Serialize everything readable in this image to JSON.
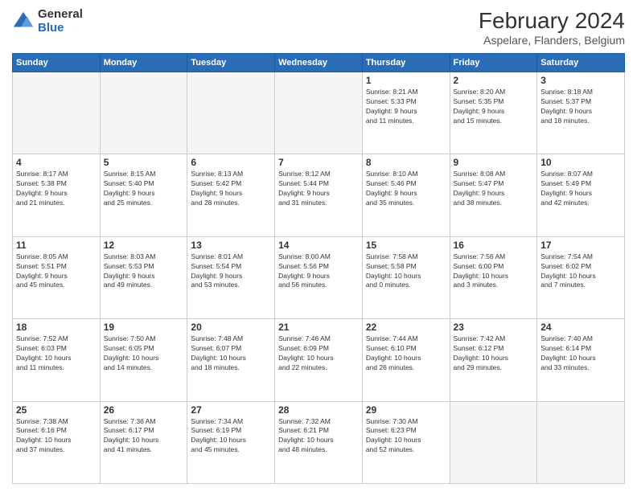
{
  "logo": {
    "general": "General",
    "blue": "Blue"
  },
  "title": "February 2024",
  "subtitle": "Aspelare, Flanders, Belgium",
  "days_of_week": [
    "Sunday",
    "Monday",
    "Tuesday",
    "Wednesday",
    "Thursday",
    "Friday",
    "Saturday"
  ],
  "weeks": [
    [
      {
        "day": "",
        "info": ""
      },
      {
        "day": "",
        "info": ""
      },
      {
        "day": "",
        "info": ""
      },
      {
        "day": "",
        "info": ""
      },
      {
        "day": "1",
        "info": "Sunrise: 8:21 AM\nSunset: 5:33 PM\nDaylight: 9 hours\nand 11 minutes."
      },
      {
        "day": "2",
        "info": "Sunrise: 8:20 AM\nSunset: 5:35 PM\nDaylight: 9 hours\nand 15 minutes."
      },
      {
        "day": "3",
        "info": "Sunrise: 8:18 AM\nSunset: 5:37 PM\nDaylight: 9 hours\nand 18 minutes."
      }
    ],
    [
      {
        "day": "4",
        "info": "Sunrise: 8:17 AM\nSunset: 5:38 PM\nDaylight: 9 hours\nand 21 minutes."
      },
      {
        "day": "5",
        "info": "Sunrise: 8:15 AM\nSunset: 5:40 PM\nDaylight: 9 hours\nand 25 minutes."
      },
      {
        "day": "6",
        "info": "Sunrise: 8:13 AM\nSunset: 5:42 PM\nDaylight: 9 hours\nand 28 minutes."
      },
      {
        "day": "7",
        "info": "Sunrise: 8:12 AM\nSunset: 5:44 PM\nDaylight: 9 hours\nand 31 minutes."
      },
      {
        "day": "8",
        "info": "Sunrise: 8:10 AM\nSunset: 5:46 PM\nDaylight: 9 hours\nand 35 minutes."
      },
      {
        "day": "9",
        "info": "Sunrise: 8:08 AM\nSunset: 5:47 PM\nDaylight: 9 hours\nand 38 minutes."
      },
      {
        "day": "10",
        "info": "Sunrise: 8:07 AM\nSunset: 5:49 PM\nDaylight: 9 hours\nand 42 minutes."
      }
    ],
    [
      {
        "day": "11",
        "info": "Sunrise: 8:05 AM\nSunset: 5:51 PM\nDaylight: 9 hours\nand 45 minutes."
      },
      {
        "day": "12",
        "info": "Sunrise: 8:03 AM\nSunset: 5:53 PM\nDaylight: 9 hours\nand 49 minutes."
      },
      {
        "day": "13",
        "info": "Sunrise: 8:01 AM\nSunset: 5:54 PM\nDaylight: 9 hours\nand 53 minutes."
      },
      {
        "day": "14",
        "info": "Sunrise: 8:00 AM\nSunset: 5:56 PM\nDaylight: 9 hours\nand 56 minutes."
      },
      {
        "day": "15",
        "info": "Sunrise: 7:58 AM\nSunset: 5:58 PM\nDaylight: 10 hours\nand 0 minutes."
      },
      {
        "day": "16",
        "info": "Sunrise: 7:56 AM\nSunset: 6:00 PM\nDaylight: 10 hours\nand 3 minutes."
      },
      {
        "day": "17",
        "info": "Sunrise: 7:54 AM\nSunset: 6:02 PM\nDaylight: 10 hours\nand 7 minutes."
      }
    ],
    [
      {
        "day": "18",
        "info": "Sunrise: 7:52 AM\nSunset: 6:03 PM\nDaylight: 10 hours\nand 11 minutes."
      },
      {
        "day": "19",
        "info": "Sunrise: 7:50 AM\nSunset: 6:05 PM\nDaylight: 10 hours\nand 14 minutes."
      },
      {
        "day": "20",
        "info": "Sunrise: 7:48 AM\nSunset: 6:07 PM\nDaylight: 10 hours\nand 18 minutes."
      },
      {
        "day": "21",
        "info": "Sunrise: 7:46 AM\nSunset: 6:09 PM\nDaylight: 10 hours\nand 22 minutes."
      },
      {
        "day": "22",
        "info": "Sunrise: 7:44 AM\nSunset: 6:10 PM\nDaylight: 10 hours\nand 26 minutes."
      },
      {
        "day": "23",
        "info": "Sunrise: 7:42 AM\nSunset: 6:12 PM\nDaylight: 10 hours\nand 29 minutes."
      },
      {
        "day": "24",
        "info": "Sunrise: 7:40 AM\nSunset: 6:14 PM\nDaylight: 10 hours\nand 33 minutes."
      }
    ],
    [
      {
        "day": "25",
        "info": "Sunrise: 7:38 AM\nSunset: 6:16 PM\nDaylight: 10 hours\nand 37 minutes."
      },
      {
        "day": "26",
        "info": "Sunrise: 7:36 AM\nSunset: 6:17 PM\nDaylight: 10 hours\nand 41 minutes."
      },
      {
        "day": "27",
        "info": "Sunrise: 7:34 AM\nSunset: 6:19 PM\nDaylight: 10 hours\nand 45 minutes."
      },
      {
        "day": "28",
        "info": "Sunrise: 7:32 AM\nSunset: 6:21 PM\nDaylight: 10 hours\nand 48 minutes."
      },
      {
        "day": "29",
        "info": "Sunrise: 7:30 AM\nSunset: 6:23 PM\nDaylight: 10 hours\nand 52 minutes."
      },
      {
        "day": "",
        "info": ""
      },
      {
        "day": "",
        "info": ""
      }
    ]
  ]
}
